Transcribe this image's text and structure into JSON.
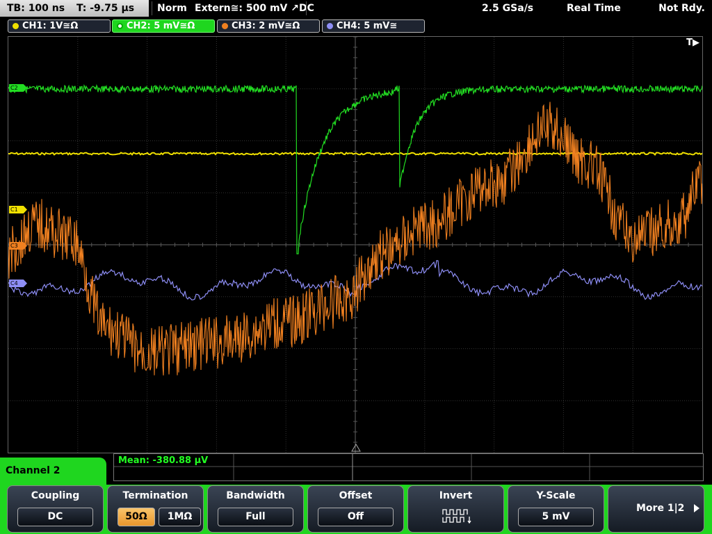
{
  "topbar": {
    "timebase": "TB: 100 ns",
    "trigger_time": "T: -9.75 µs",
    "trigger_mode": "Norm",
    "trigger_source": "Extern≅: 500 mV ↗DC",
    "sample_rate": "2.5 GSa/s",
    "acquisition_mode": "Real Time",
    "acquisition_state": "Not Rdy."
  },
  "channels": [
    {
      "id": "ch1",
      "label": "CH1: 1V≅Ω",
      "color": "#f0e000",
      "marker": "C1"
    },
    {
      "id": "ch2",
      "label": "CH2: 5 mV≅Ω",
      "color": "#22dd22",
      "marker": "C2"
    },
    {
      "id": "ch3",
      "label": "CH3: 2 mV≅Ω",
      "color": "#f08020",
      "marker": "C3"
    },
    {
      "id": "ch4",
      "label": "CH4: 5 mV≅",
      "color": "#8e8ef5",
      "marker": "C4"
    }
  ],
  "trigger_indicator": "T▶",
  "measurement": {
    "mean": "Mean: -380.88 µV"
  },
  "menu": {
    "title": "Channel 2",
    "softkeys": {
      "coupling": {
        "label": "Coupling",
        "value": "DC"
      },
      "termination": {
        "label": "Termination",
        "option_a": "50Ω",
        "option_b": "1MΩ"
      },
      "bandwidth": {
        "label": "Bandwidth",
        "value": "Full"
      },
      "offset": {
        "label": "Offset",
        "value": "Off"
      },
      "invert": {
        "label": "Invert"
      },
      "yscale": {
        "label": "Y-Scale",
        "value": "5 mV"
      },
      "more": {
        "label": "More 1|2"
      }
    }
  },
  "colors": {
    "accent": "#1fd61f",
    "selected_option": "#e8962c",
    "grid": "#404040"
  }
}
